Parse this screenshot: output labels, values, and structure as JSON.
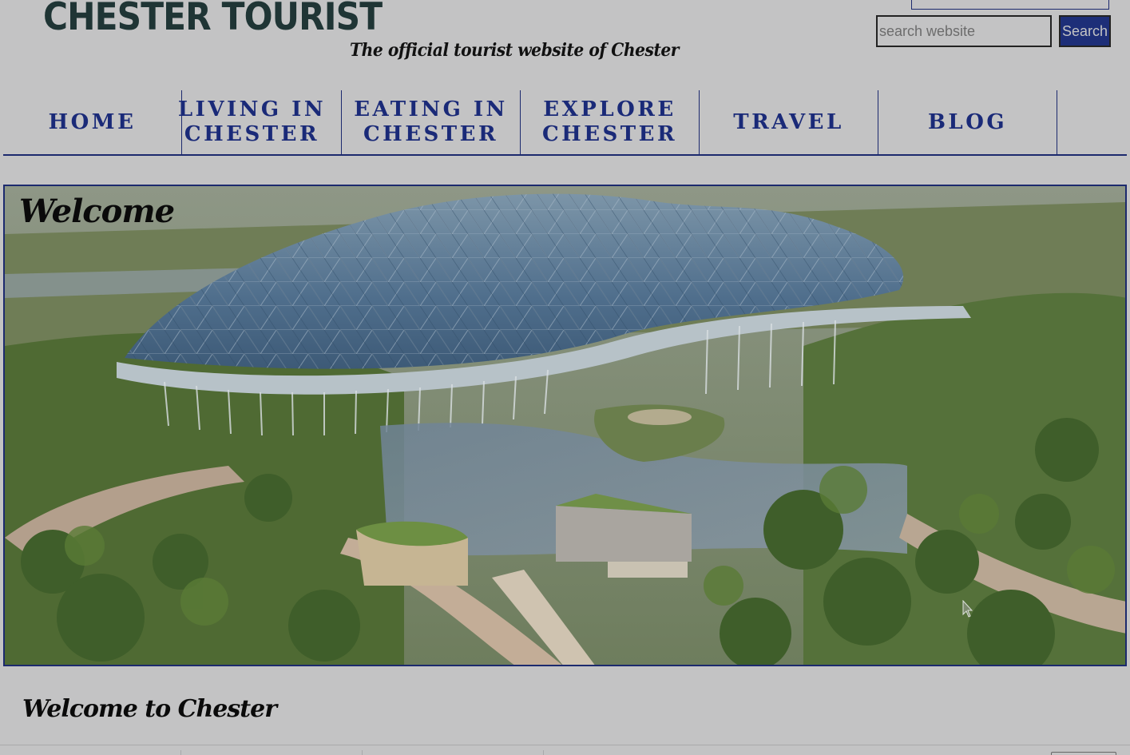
{
  "header": {
    "site_title": "CHESTER TOURIST",
    "tagline": "The official tourist website of Chester"
  },
  "search": {
    "placeholder": "search website",
    "value": "",
    "button_label": "Search"
  },
  "nav": {
    "items": [
      {
        "line1": "HOME",
        "line2": ""
      },
      {
        "line1": "LIVING IN",
        "line2": "CHESTER"
      },
      {
        "line1": "EATING IN",
        "line2": "CHESTER"
      },
      {
        "line1": "EXPLORE",
        "line2": "CHESTER"
      },
      {
        "line1": "TRAVEL",
        "line2": ""
      },
      {
        "line1": "BLOG",
        "line2": ""
      }
    ]
  },
  "hero": {
    "title": "Welcome"
  },
  "main": {
    "section_title": "Welcome to Chester"
  },
  "colors": {
    "background": "#c3c3c4",
    "nav_text": "#1a2a78",
    "accent_border": "#1c2a6e",
    "button_bg": "#1d2e78",
    "title_text": "#1f3535"
  },
  "icons": {
    "cursor": "pointer-arrow-icon"
  }
}
